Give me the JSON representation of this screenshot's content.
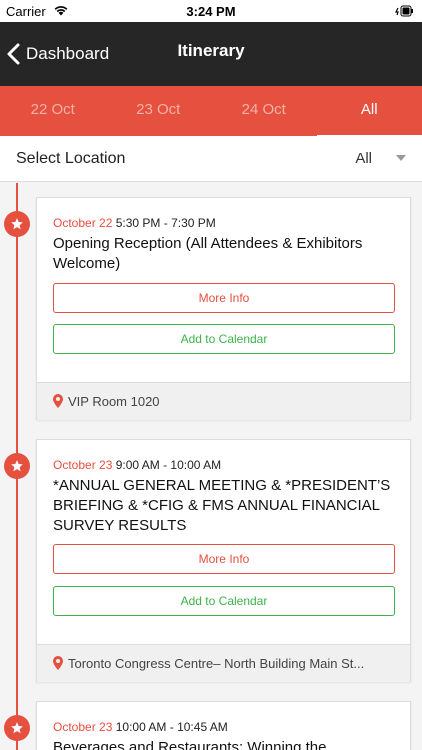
{
  "status_bar": {
    "carrier": "Carrier",
    "time": "3:24 PM"
  },
  "nav": {
    "back_label": "Dashboard",
    "title": "Itinerary"
  },
  "tabs": [
    {
      "label": "22 Oct",
      "active": false
    },
    {
      "label": "23 Oct",
      "active": false
    },
    {
      "label": "24 Oct",
      "active": false
    },
    {
      "label": "All",
      "active": true
    }
  ],
  "location": {
    "label": "Select Location",
    "value": "All"
  },
  "colors": {
    "accent": "#e5503f",
    "calendar": "#3cb34a",
    "nav_bg": "#262626"
  },
  "events": [
    {
      "date": "October 22",
      "time": "5:30 PM - 7:30 PM",
      "title": "Opening Reception (All Attendees & Exhibitors Welcome)",
      "more_info": "More Info",
      "add_calendar": "Add to Calendar",
      "venue": "VIP Room 1020"
    },
    {
      "date": "October 23",
      "time": "9:00 AM - 10:00 AM",
      "title": "*ANNUAL GENERAL MEETING & *PRESIDENT’S BRIEFING & *CFIG & FMS ANNUAL FINANCIAL SURVEY RESULTS",
      "more_info": "More Info",
      "add_calendar": "Add to Calendar",
      "venue": "Toronto Congress Centre– North Building Main St..."
    },
    {
      "date": "October 23",
      "time": "10:00 AM - 10:45 AM",
      "title": "Beverages and Restaurants: Winning the"
    }
  ]
}
